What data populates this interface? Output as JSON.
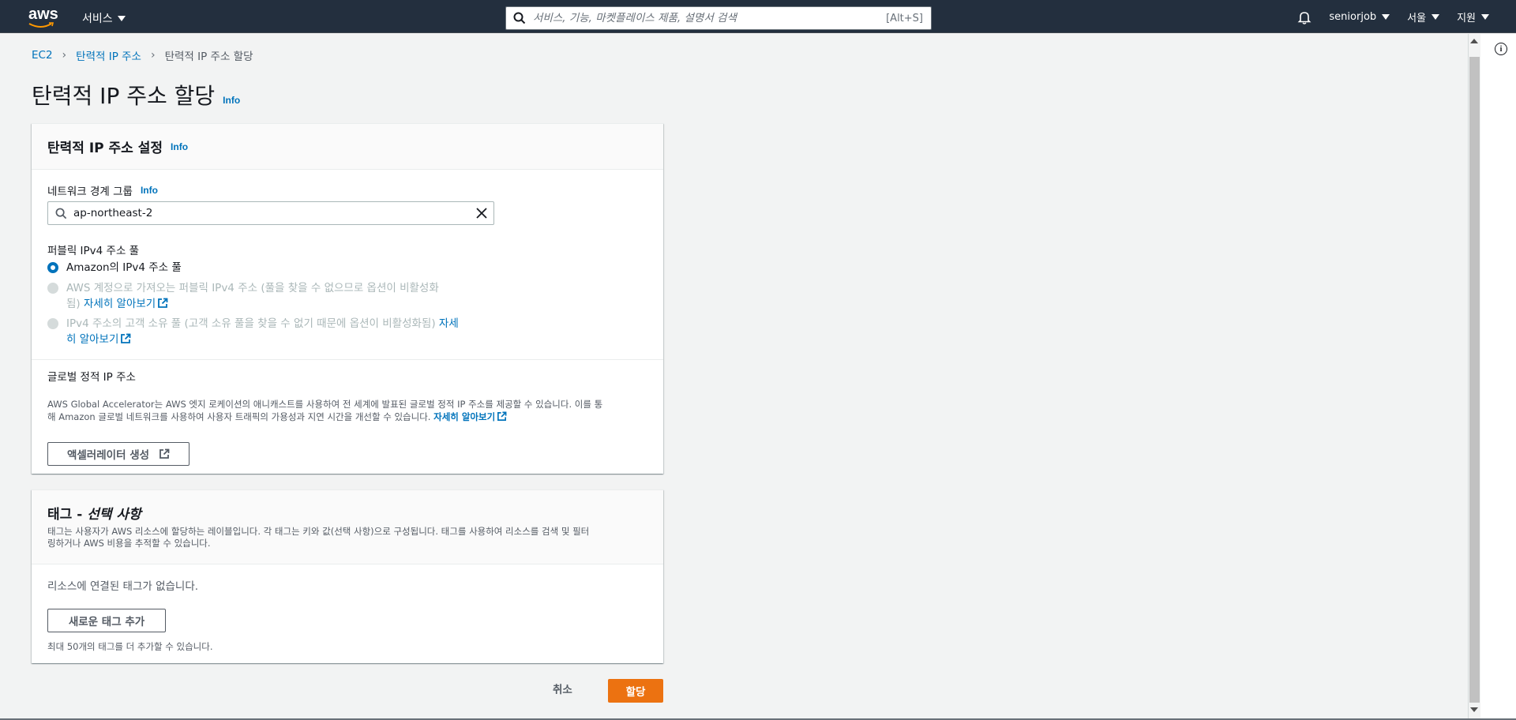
{
  "topbar": {
    "logo": "aws",
    "services_label": "서비스",
    "search_placeholder": "서비스, 기능, 마켓플레이스 제품, 설명서 검색",
    "search_shortcut": "[Alt+S]",
    "user": "seniorjob",
    "region": "서울",
    "support": "지원"
  },
  "breadcrumb": {
    "items": [
      "EC2",
      "탄력적 IP 주소",
      "탄력적 IP 주소 할당"
    ]
  },
  "page": {
    "title": "탄력적 IP 주소 할당",
    "info": "Info"
  },
  "settings_panel": {
    "title": "탄력적 IP 주소 설정",
    "info": "Info",
    "network_border_group_label": "네트워크 경계 그룹",
    "network_border_group_info": "Info",
    "network_border_group_value": "ap-northeast-2",
    "pool_label": "퍼블릭 IPv4 주소 풀",
    "pool_options": [
      {
        "label": "Amazon의 IPv4 주소 풀",
        "selected": true,
        "disabled": false
      },
      {
        "line1": "AWS 계정으로 가져오는 퍼블릭 IPv4 주소 (풀을 찾을 수 없으므로 옵션이 비활성화",
        "line2": "됨)",
        "link": "자세히 알아보기",
        "selected": false,
        "disabled": true
      },
      {
        "line1": "IPv4 주소의 고객 소유 풀 (고객 소유 풀을 찾을 수 없기 때문에 옵션이 비활성화됨)",
        "link1": "자세",
        "link2": "히 알아보기",
        "selected": false,
        "disabled": true
      }
    ],
    "global_ip_label": "글로벌 정적 IP 주소",
    "global_ip_desc1": "AWS Global Accelerator는 AWS 엣지 로케이션의 애니캐스트를 사용하여 전 세계에 발표된 글로벌 정적 IP 주소를 제공할 수 있습니다. 이를 통",
    "global_ip_desc2": "해 Amazon 글로벌 네트워크를 사용하여 사용자 트래픽의 가용성과 지연 시간을 개선할 수 있습니다.",
    "global_ip_link": "자세히 알아보기",
    "create_accelerator_button": "액셀러레이터 생성"
  },
  "tags_panel": {
    "title_prefix": "태그 -",
    "title_suffix": "선택 사항",
    "desc1": "태그는 사용자가 AWS 리소스에 할당하는 레이블입니다. 각 태그는 키와 값(선택 사항)으로 구성됩니다. 태그를 사용하여 리소스를 검색 및 필터",
    "desc2": "링하거나 AWS 비용을 추적할 수 있습니다.",
    "empty_text": "리소스에 연결된 태그가 없습니다.",
    "add_tag_button": "새로운 태그 추가",
    "limit_text": "최대 50개의 태그를 더 추가할 수 있습니다."
  },
  "actions": {
    "cancel": "취소",
    "allocate": "할당"
  },
  "colors": {
    "topbar_bg": "#232f3e",
    "link": "#0073bb",
    "primary_button": "#ec7211"
  }
}
